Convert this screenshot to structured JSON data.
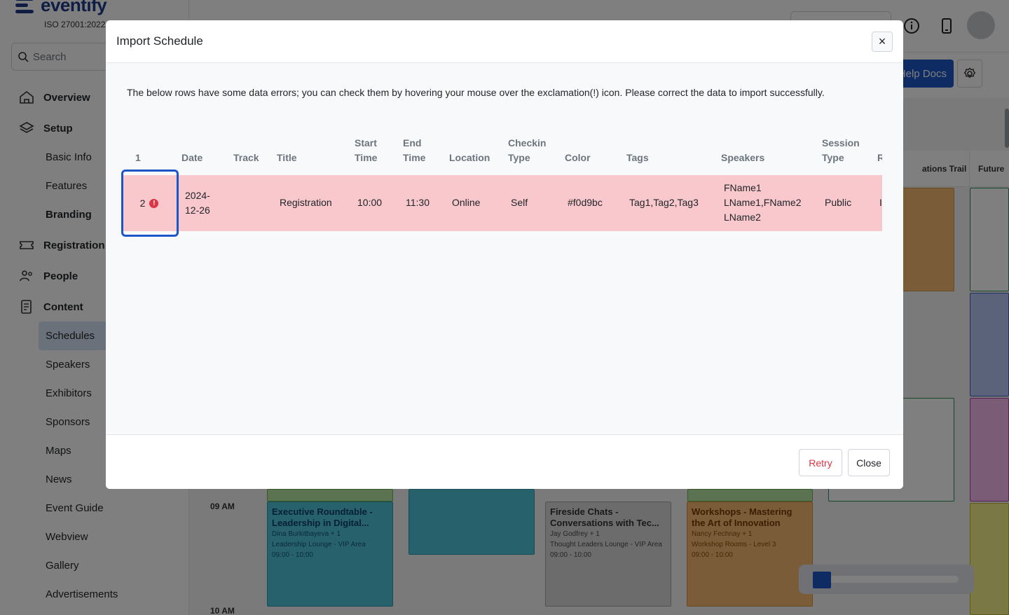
{
  "app": {
    "logo_text": "eventify",
    "iso_text": "ISO 27001:2022",
    "search_placeholder": "Search",
    "help_docs_label": "Help Docs",
    "brand_color": "#1d56c8"
  },
  "sidebar": {
    "sections": [
      {
        "label": "Overview",
        "icon": "home-icon"
      },
      {
        "label": "Setup",
        "icon": "layers-icon"
      },
      {
        "label": "Basic Info",
        "sub": true
      },
      {
        "label": "Features",
        "sub": true
      },
      {
        "label": "Branding",
        "sub": true,
        "bold": true
      },
      {
        "label": "Registration",
        "icon": "ticket-icon"
      },
      {
        "label": "People",
        "icon": "people-icon"
      },
      {
        "label": "Content",
        "icon": "content-icon"
      },
      {
        "label": "Schedules",
        "sub": true,
        "active": true
      },
      {
        "label": "Speakers",
        "sub": true
      },
      {
        "label": "Exhibitors",
        "sub": true
      },
      {
        "label": "Sponsors",
        "sub": true
      },
      {
        "label": "Maps",
        "sub": true
      },
      {
        "label": "News",
        "sub": true
      },
      {
        "label": "Event Guide",
        "sub": true
      },
      {
        "label": "Webview",
        "sub": true
      },
      {
        "label": "Gallery",
        "sub": true
      },
      {
        "label": "Advertisements",
        "sub": true
      }
    ]
  },
  "schedule_bg": {
    "column_headers": [
      "ations Trail",
      "Future"
    ],
    "time_labels": [
      "09 AM",
      "10 AM"
    ],
    "cards": [
      {
        "title": "Executive Roundtable - Leadership in Digital...",
        "speaker": "Dina Burkitbayeva + 1",
        "location": "Leadership Lounge - VIP Area",
        "time": "09:00 - 10:00",
        "bg": "#4fc3d9",
        "border": "#2a9cb2"
      },
      {
        "title": "Fireside Chats - Conversations with Tec...",
        "speaker": "Jay Godfrey + 1",
        "location": "Thought Leaders Lounge - VIP Area",
        "time": "09:00 - 10:00",
        "bg": "#d9d9d9",
        "border": "#a6a6a6"
      },
      {
        "title": "Workshops - Mastering the Art of Innovation",
        "speaker": "Nancy Fechnay + 1",
        "location": "Workshop Rooms - Level 3",
        "time": "09:00 - 10:00",
        "bg": "#f6b872",
        "border": "#d9924a"
      }
    ]
  },
  "modal": {
    "title": "Import Schedule",
    "close_symbol": "×",
    "notice": "The below rows have some data errors; you can check them by hovering your mouse over the exclamation(!) icon. Please correct the data to import successfully.",
    "table": {
      "headers": [
        {
          "label": "1"
        },
        {
          "label": "Date"
        },
        {
          "label": "Track"
        },
        {
          "label": "Title"
        },
        {
          "label": "Start Time"
        },
        {
          "label": "End Time"
        },
        {
          "label": "Location"
        },
        {
          "label": "Checkin Type"
        },
        {
          "label": "Color"
        },
        {
          "label": "Tags"
        },
        {
          "label": "Speakers"
        },
        {
          "label": "Session Type"
        },
        {
          "label": "R"
        }
      ],
      "row": {
        "number": "2",
        "error_icon": "exclamation-icon",
        "date": "2024-12-26",
        "track": "",
        "title": "Registration",
        "start_time": "10:00",
        "end_time": "11:30",
        "location": "Online",
        "checkin_type": "Self",
        "color": "#f0d9bc",
        "tags": "Tag1,Tag2,Tag3",
        "speakers": "FName1 LName1,FName2 LName2",
        "session_type": "Public",
        "extra": "I"
      },
      "row_error_color": "#f8c8cd"
    },
    "buttons": {
      "retry": "Retry",
      "close": "Close"
    }
  }
}
